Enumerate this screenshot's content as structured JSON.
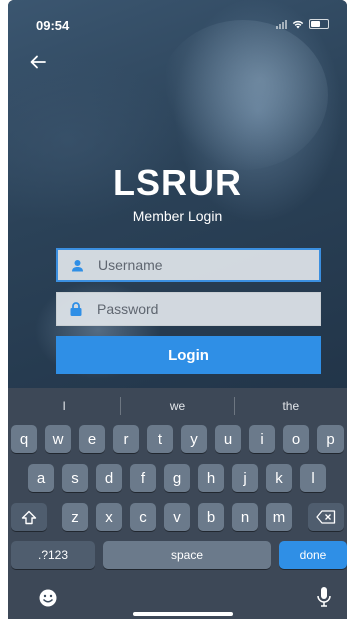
{
  "status_bar": {
    "time": "09:54",
    "icons": [
      "signal-icon",
      "wifi-icon",
      "battery-icon"
    ]
  },
  "nav": {
    "back_icon": "arrow-left-icon"
  },
  "app": {
    "title": "LSRUR",
    "subtitle": "Member Login"
  },
  "form": {
    "username": {
      "placeholder": "Username",
      "value": "",
      "icon": "user-icon"
    },
    "password": {
      "placeholder": "Password",
      "value": "",
      "icon": "lock-icon"
    },
    "login_label": "Login"
  },
  "colors": {
    "accent": "#2f8fe6",
    "focus_border": "#3b8fe0"
  },
  "keyboard": {
    "suggestions": [
      "I",
      "we",
      "the"
    ],
    "row1": [
      "q",
      "w",
      "e",
      "r",
      "t",
      "y",
      "u",
      "i",
      "o",
      "p"
    ],
    "row2": [
      "a",
      "s",
      "d",
      "f",
      "g",
      "h",
      "j",
      "k",
      "l"
    ],
    "row3": [
      "z",
      "x",
      "c",
      "v",
      "b",
      "n",
      "m"
    ],
    "numbers_label": ".?123",
    "space_label": "space",
    "done_label": "done",
    "bottom_icons": [
      "emoji-icon",
      "microphone-icon"
    ]
  }
}
